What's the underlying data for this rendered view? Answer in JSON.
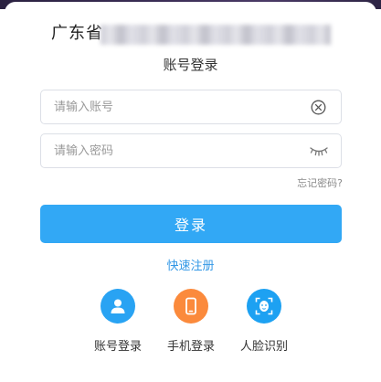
{
  "header": {
    "org_prefix": "广东省"
  },
  "login": {
    "heading": "账号登录",
    "account_placeholder": "请输入账号",
    "password_placeholder": "请输入密码",
    "forgot_label": "忘记密码?",
    "submit_label": "登录",
    "register_label": "快速注册"
  },
  "methods": [
    {
      "label": "账号登录",
      "icon": "user-icon",
      "color": "#29a3f3"
    },
    {
      "label": "手机登录",
      "icon": "phone-icon",
      "color": "#fb8a3c"
    },
    {
      "label": "人脸识别",
      "icon": "face-scan-icon",
      "color": "#1da1f2"
    }
  ],
  "colors": {
    "primary": "#32a8f5",
    "link": "#3398e6"
  }
}
